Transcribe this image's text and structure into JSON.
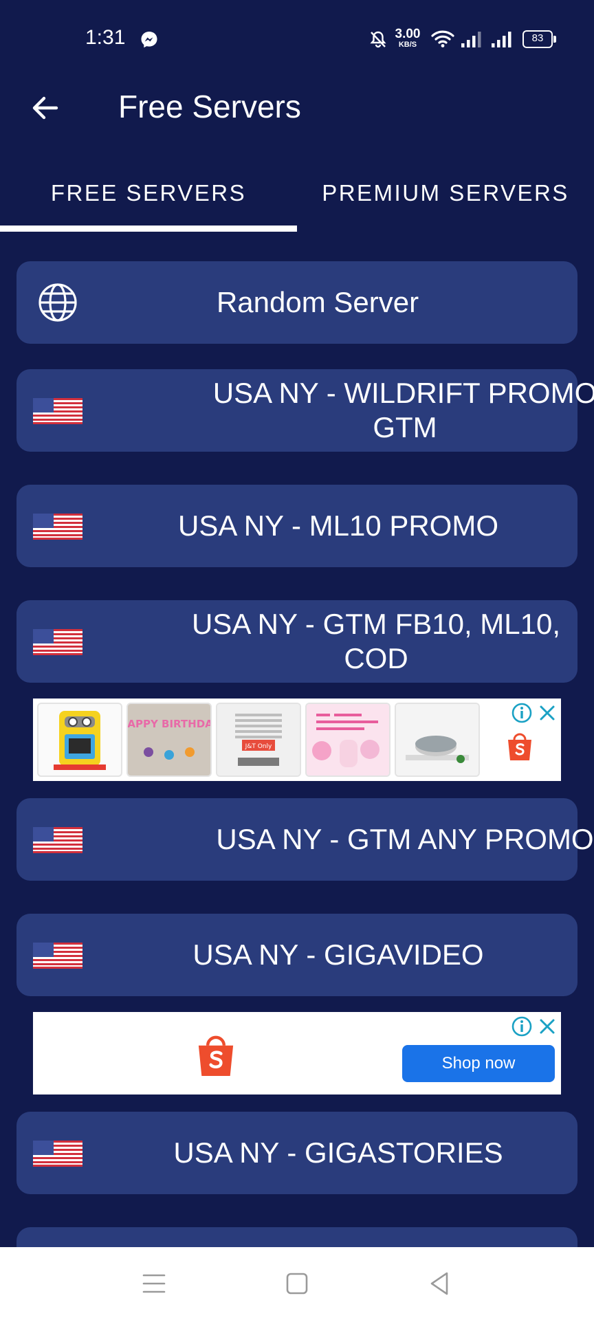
{
  "status_bar": {
    "time": "1:31",
    "net_speed_value": "3.00",
    "net_speed_unit": "KB/S",
    "battery": "83",
    "icons": [
      "messenger-icon",
      "bell-off-icon",
      "wifi-icon",
      "signal-icon",
      "signal-icon",
      "battery-icon"
    ]
  },
  "app_bar": {
    "title": "Free Servers",
    "back_icon": "arrow-left-icon"
  },
  "tabs": [
    {
      "label": "FREE SERVERS",
      "selected": true
    },
    {
      "label": "PREMIUM SERVERS",
      "selected": false
    }
  ],
  "servers": [
    {
      "name": "Random Server",
      "icon": "globe-icon"
    },
    {
      "name": "USA NY - WILDRIFT PROMO GTM",
      "icon": "us-flag-icon"
    },
    {
      "name": "USA NY - ML10 PROMO",
      "icon": "us-flag-icon"
    },
    {
      "name": "USA NY - GTM FB10, ML10, COD",
      "icon": "us-flag-icon"
    },
    {
      "name": "USA NY - GTM ANY PROMO",
      "icon": "us-flag-icon"
    },
    {
      "name": "USA NY - GIGAVIDEO",
      "icon": "us-flag-icon"
    },
    {
      "name": "USA NY - GIGASTORIES",
      "icon": "us-flag-icon"
    }
  ],
  "ads": {
    "banner_1": {
      "thumb_1_label": "",
      "thumb_2_text": "HAPPY BIRTHDAY",
      "thumb_3_text": "J&T Only",
      "thumb_4_label": "",
      "thumb_5_label": "",
      "brand_icon": "shopee-bag-icon"
    },
    "banner_2": {
      "button_label": "Shop now",
      "brand_icon": "shopee-bag-icon"
    }
  },
  "colors": {
    "background": "#111a4d",
    "card": "#2a3c7c",
    "ad_button": "#1a73e8",
    "shopee": "#ee4d2d"
  },
  "nav_bar": {
    "icons": [
      "menu-icon",
      "home-square-icon",
      "back-triangle-icon"
    ]
  }
}
